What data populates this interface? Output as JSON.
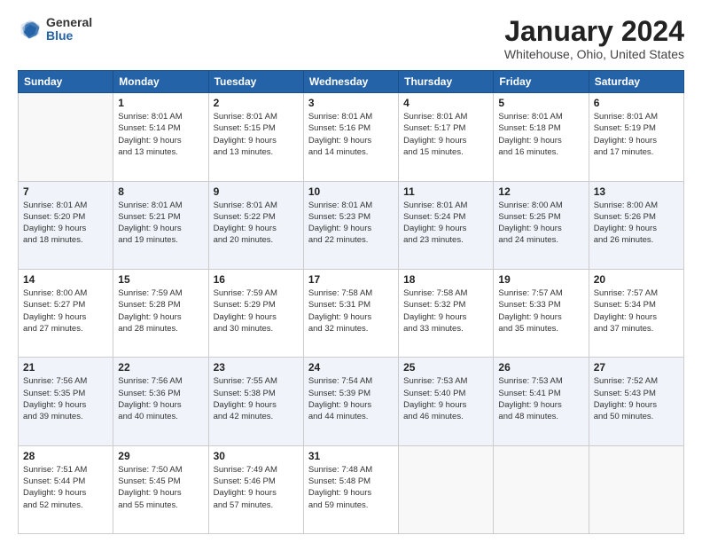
{
  "logo": {
    "general": "General",
    "blue": "Blue"
  },
  "title": "January 2024",
  "location": "Whitehouse, Ohio, United States",
  "days_header": [
    "Sunday",
    "Monday",
    "Tuesday",
    "Wednesday",
    "Thursday",
    "Friday",
    "Saturday"
  ],
  "weeks": [
    [
      {
        "day": "",
        "info": ""
      },
      {
        "day": "1",
        "info": "Sunrise: 8:01 AM\nSunset: 5:14 PM\nDaylight: 9 hours\nand 13 minutes."
      },
      {
        "day": "2",
        "info": "Sunrise: 8:01 AM\nSunset: 5:15 PM\nDaylight: 9 hours\nand 13 minutes."
      },
      {
        "day": "3",
        "info": "Sunrise: 8:01 AM\nSunset: 5:16 PM\nDaylight: 9 hours\nand 14 minutes."
      },
      {
        "day": "4",
        "info": "Sunrise: 8:01 AM\nSunset: 5:17 PM\nDaylight: 9 hours\nand 15 minutes."
      },
      {
        "day": "5",
        "info": "Sunrise: 8:01 AM\nSunset: 5:18 PM\nDaylight: 9 hours\nand 16 minutes."
      },
      {
        "day": "6",
        "info": "Sunrise: 8:01 AM\nSunset: 5:19 PM\nDaylight: 9 hours\nand 17 minutes."
      }
    ],
    [
      {
        "day": "7",
        "info": "Sunrise: 8:01 AM\nSunset: 5:20 PM\nDaylight: 9 hours\nand 18 minutes."
      },
      {
        "day": "8",
        "info": "Sunrise: 8:01 AM\nSunset: 5:21 PM\nDaylight: 9 hours\nand 19 minutes."
      },
      {
        "day": "9",
        "info": "Sunrise: 8:01 AM\nSunset: 5:22 PM\nDaylight: 9 hours\nand 20 minutes."
      },
      {
        "day": "10",
        "info": "Sunrise: 8:01 AM\nSunset: 5:23 PM\nDaylight: 9 hours\nand 22 minutes."
      },
      {
        "day": "11",
        "info": "Sunrise: 8:01 AM\nSunset: 5:24 PM\nDaylight: 9 hours\nand 23 minutes."
      },
      {
        "day": "12",
        "info": "Sunrise: 8:00 AM\nSunset: 5:25 PM\nDaylight: 9 hours\nand 24 minutes."
      },
      {
        "day": "13",
        "info": "Sunrise: 8:00 AM\nSunset: 5:26 PM\nDaylight: 9 hours\nand 26 minutes."
      }
    ],
    [
      {
        "day": "14",
        "info": "Sunrise: 8:00 AM\nSunset: 5:27 PM\nDaylight: 9 hours\nand 27 minutes."
      },
      {
        "day": "15",
        "info": "Sunrise: 7:59 AM\nSunset: 5:28 PM\nDaylight: 9 hours\nand 28 minutes."
      },
      {
        "day": "16",
        "info": "Sunrise: 7:59 AM\nSunset: 5:29 PM\nDaylight: 9 hours\nand 30 minutes."
      },
      {
        "day": "17",
        "info": "Sunrise: 7:58 AM\nSunset: 5:31 PM\nDaylight: 9 hours\nand 32 minutes."
      },
      {
        "day": "18",
        "info": "Sunrise: 7:58 AM\nSunset: 5:32 PM\nDaylight: 9 hours\nand 33 minutes."
      },
      {
        "day": "19",
        "info": "Sunrise: 7:57 AM\nSunset: 5:33 PM\nDaylight: 9 hours\nand 35 minutes."
      },
      {
        "day": "20",
        "info": "Sunrise: 7:57 AM\nSunset: 5:34 PM\nDaylight: 9 hours\nand 37 minutes."
      }
    ],
    [
      {
        "day": "21",
        "info": "Sunrise: 7:56 AM\nSunset: 5:35 PM\nDaylight: 9 hours\nand 39 minutes."
      },
      {
        "day": "22",
        "info": "Sunrise: 7:56 AM\nSunset: 5:36 PM\nDaylight: 9 hours\nand 40 minutes."
      },
      {
        "day": "23",
        "info": "Sunrise: 7:55 AM\nSunset: 5:38 PM\nDaylight: 9 hours\nand 42 minutes."
      },
      {
        "day": "24",
        "info": "Sunrise: 7:54 AM\nSunset: 5:39 PM\nDaylight: 9 hours\nand 44 minutes."
      },
      {
        "day": "25",
        "info": "Sunrise: 7:53 AM\nSunset: 5:40 PM\nDaylight: 9 hours\nand 46 minutes."
      },
      {
        "day": "26",
        "info": "Sunrise: 7:53 AM\nSunset: 5:41 PM\nDaylight: 9 hours\nand 48 minutes."
      },
      {
        "day": "27",
        "info": "Sunrise: 7:52 AM\nSunset: 5:43 PM\nDaylight: 9 hours\nand 50 minutes."
      }
    ],
    [
      {
        "day": "28",
        "info": "Sunrise: 7:51 AM\nSunset: 5:44 PM\nDaylight: 9 hours\nand 52 minutes."
      },
      {
        "day": "29",
        "info": "Sunrise: 7:50 AM\nSunset: 5:45 PM\nDaylight: 9 hours\nand 55 minutes."
      },
      {
        "day": "30",
        "info": "Sunrise: 7:49 AM\nSunset: 5:46 PM\nDaylight: 9 hours\nand 57 minutes."
      },
      {
        "day": "31",
        "info": "Sunrise: 7:48 AM\nSunset: 5:48 PM\nDaylight: 9 hours\nand 59 minutes."
      },
      {
        "day": "",
        "info": ""
      },
      {
        "day": "",
        "info": ""
      },
      {
        "day": "",
        "info": ""
      }
    ]
  ]
}
